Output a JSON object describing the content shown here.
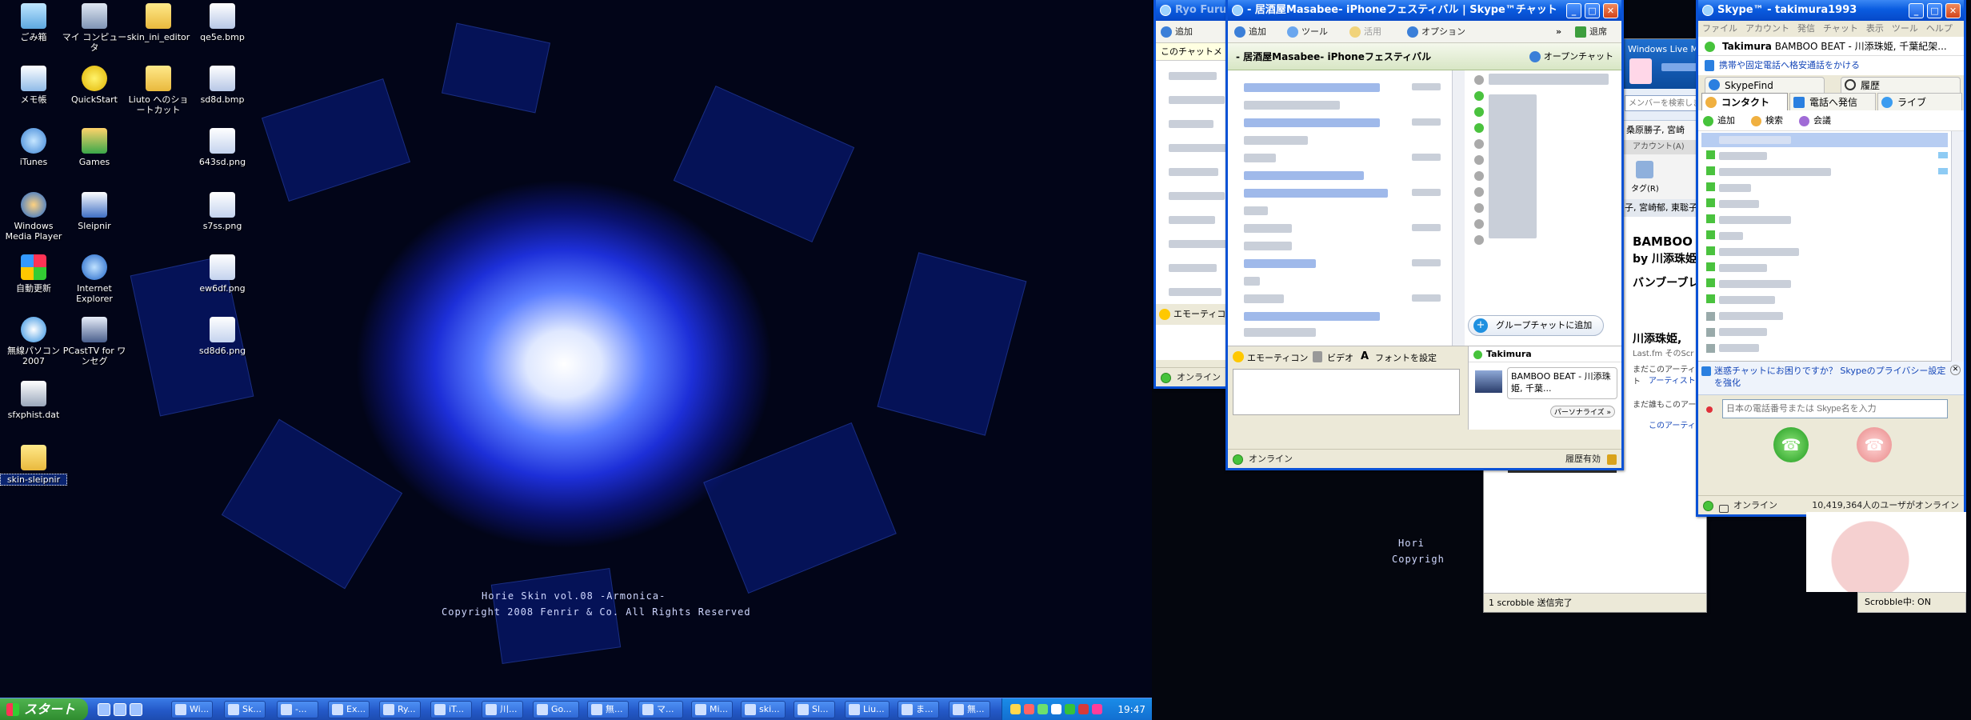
{
  "desktop_icons": [
    {
      "label": "ごみ箱",
      "icon": "recycle-bin-icon"
    },
    {
      "label": "マイ コンピュータ",
      "icon": "my-computer-icon"
    },
    {
      "label": "skin_ini_editor",
      "icon": "folder-icon"
    },
    {
      "label": "qe5e.bmp",
      "icon": "image-file-icon"
    },
    {
      "label": "メモ帳",
      "icon": "notepad-icon"
    },
    {
      "label": "QuickStart",
      "icon": "star-icon"
    },
    {
      "label": "Liuto へのショートカット",
      "icon": "folder-shortcut-icon"
    },
    {
      "label": "sd8d.bmp",
      "icon": "image-file-icon"
    },
    {
      "label": "iTunes",
      "icon": "itunes-icon"
    },
    {
      "label": "Games",
      "icon": "games-icon"
    },
    {
      "label": "643sd.png",
      "icon": "png-file-icon"
    },
    {
      "label": "Windows Media Player",
      "icon": "media-player-icon"
    },
    {
      "label": "Sleipnir",
      "icon": "sleipnir-icon"
    },
    {
      "label": "s7ss.png",
      "icon": "png-file-icon"
    },
    {
      "label": "自動更新",
      "icon": "windows-update-icon"
    },
    {
      "label": "Internet Explorer",
      "icon": "internet-explorer-icon"
    },
    {
      "label": "ew6df.png",
      "icon": "png-file-icon"
    },
    {
      "label": "無線パソコン 2007",
      "icon": "network-icon"
    },
    {
      "label": "PCastTV for ワンセグ",
      "icon": "tv-icon"
    },
    {
      "label": "sd8d6.png",
      "icon": "png-file-icon"
    },
    {
      "label": "sfxphist.dat",
      "icon": "dat-file-icon"
    },
    {
      "label": "skin-sleipnir",
      "icon": "folder-icon"
    }
  ],
  "wallpaper": {
    "line1": "Horie Skin vol.08 -Armonica-",
    "line2": "Copyright 2008 Fenrir & Co. All Rights Reserved",
    "right_line1": "Hori",
    "right_line2": "Copyrigh"
  },
  "taskbar": {
    "start_label": "スタート",
    "buttons": [
      "Wi...",
      "Sk...",
      "-...",
      "Ex...",
      "Ry...",
      "iT...",
      "川...",
      "Go...",
      "無...",
      "マ...",
      "Mi...",
      "ski...",
      "Sl...",
      "Liu...",
      "ま...",
      "無..."
    ],
    "clock": "19:47"
  },
  "back_chat": {
    "title": "Ryo Furusawa",
    "add_label": "追加",
    "notice": "このチャットメ",
    "emoticon": "エモーティコ",
    "status": "オンライン"
  },
  "chat_window": {
    "title": "- 居酒屋Masabee- iPhoneフェスティバル | Skype™チャット",
    "toolbar": {
      "add": "追加",
      "tools": "ツール",
      "use": "活用",
      "options": "オプション",
      "more": "»",
      "exit": "退席"
    },
    "topic": "- 居酒屋Masabee- iPhoneフェスティバル",
    "open_chat": "オープンチャット",
    "add_to_group": "グループチャットに追加",
    "profile_name": "Takimura",
    "profile_mood": "BAMBOO BEAT - 川添珠姫, 千葉...",
    "personalize": "パーソナライズ »",
    "compose_bar": {
      "emoticon": "エモーティコン",
      "video": "ビデオ",
      "font": "フォントを設定"
    },
    "status": "オンライン",
    "history": "履歴有効"
  },
  "browser": {
    "tab_title": "Windows Live Me",
    "search_placeholder": "メンバーを検索します",
    "artist_names": "桑原勝子, 宮崎",
    "account": "アカウント(A)",
    "tag": "タグ(R)",
    "artists_line": "子, 宮崎郁, 東聡子",
    "track_line1": "BAMBOO",
    "track_line2": "by 川添珠姫",
    "track_kana": "バンブーブレ",
    "artist_heading": "川添珠姫, ",
    "lastfm": "Last.fm そのScr",
    "no_artist": "まだこのアーティスト",
    "artist_link": "アーティストの",
    "no_tag": "まだ誰もこのアーティストにタグを付けていません",
    "tag_link": "このアーティストにタグを付ける...",
    "scrobble": "1 scrobble 送信完了",
    "scrobble_state": "Scrobble中: ON"
  },
  "skype_main": {
    "title": "Skype™ - takimura1993",
    "menu": [
      "ファイル",
      "アカウント",
      "発信",
      "チャット",
      "表示",
      "ツール",
      "ヘルプ"
    ],
    "user": "Takimura",
    "mood": "BAMBOO BEAT - 川添珠姫, 千葉紀架...",
    "promo": "携帯や固定電話へ格安通話をかける",
    "tabs": {
      "skypefind": "SkypeFind",
      "history": "履歴",
      "contacts": "コンタクト",
      "call_phone": "電話へ発信",
      "live": "ライブ"
    },
    "actions": {
      "add": "追加",
      "search": "検索",
      "conference": "会議"
    },
    "privacy_text": "迷惑チャットにお困りですか？ Skypeのプライバシー設定を強化",
    "phone_placeholder": "日本の電話番号または Skype名を入力",
    "status": "オンライン",
    "online_count": "10,419,364人のユーザがオンライン"
  }
}
